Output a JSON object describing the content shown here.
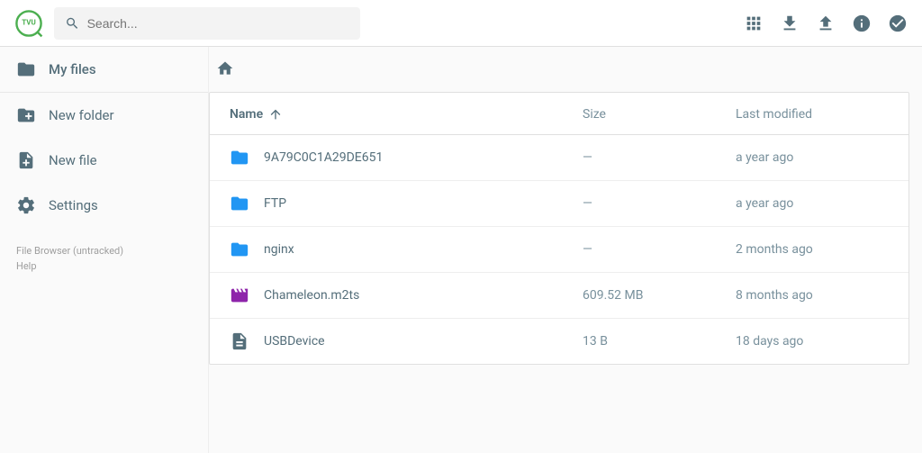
{
  "brand": "TVU",
  "search": {
    "placeholder": "Search..."
  },
  "sidebar": {
    "items": [
      {
        "label": "My files"
      },
      {
        "label": "New folder"
      },
      {
        "label": "New file"
      },
      {
        "label": "Settings"
      }
    ],
    "footer_line1": "File Browser (untracked)",
    "footer_line2": "Help"
  },
  "columns": {
    "name": "Name",
    "size": "Size",
    "modified": "Last modified"
  },
  "files": [
    {
      "icon": "folder",
      "name": "9A79C0C1A29DE651",
      "size": "—",
      "modified": "a year ago"
    },
    {
      "icon": "folder",
      "name": "FTP",
      "size": "—",
      "modified": "a year ago"
    },
    {
      "icon": "folder",
      "name": "nginx",
      "size": "—",
      "modified": "2 months ago"
    },
    {
      "icon": "movie",
      "name": "Chameleon.m2ts",
      "size": "609.52 MB",
      "modified": "8 months ago"
    },
    {
      "icon": "doc",
      "name": "USBDevice",
      "size": "13 B",
      "modified": "18 days ago"
    }
  ]
}
